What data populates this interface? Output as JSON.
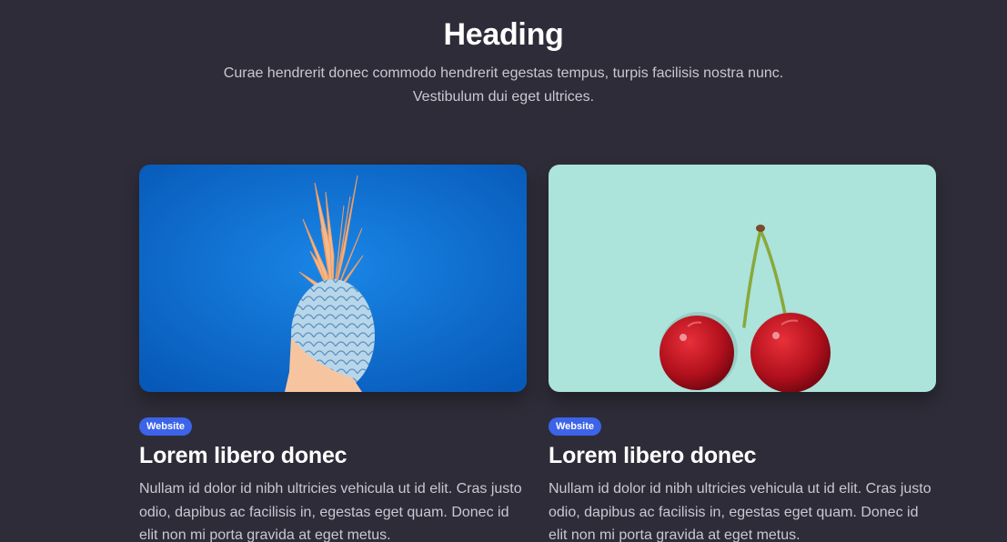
{
  "header": {
    "title": "Heading",
    "subtitle": "Curae hendrerit donec commodo hendrerit egestas tempus, turpis facilisis nostra nunc. Vestibulum dui eget ultrices."
  },
  "cards": [
    {
      "badge": "Website",
      "title": "Lorem libero donec",
      "text": "Nullam id dolor id nibh ultricies vehicula ut id elit. Cras justo odio, dapibus ac facilisis in, egestas eget quam. Donec id elit non mi porta gravida at eget metus.",
      "image_icon": "pineapple-photo",
      "image_background": "#0b6fd1"
    },
    {
      "badge": "Website",
      "title": "Lorem libero donec",
      "text": "Nullam id dolor id nibh ultricies vehicula ut id elit. Cras justo odio, dapibus ac facilisis in, egestas eget quam. Donec id elit non mi porta gravida at eget metus.",
      "image_icon": "cherries-photo",
      "image_background": "#ace3db"
    }
  ],
  "colors": {
    "page_background": "#2d2c38",
    "badge": "#3d63e8",
    "muted_text": "#c9c9d1"
  }
}
